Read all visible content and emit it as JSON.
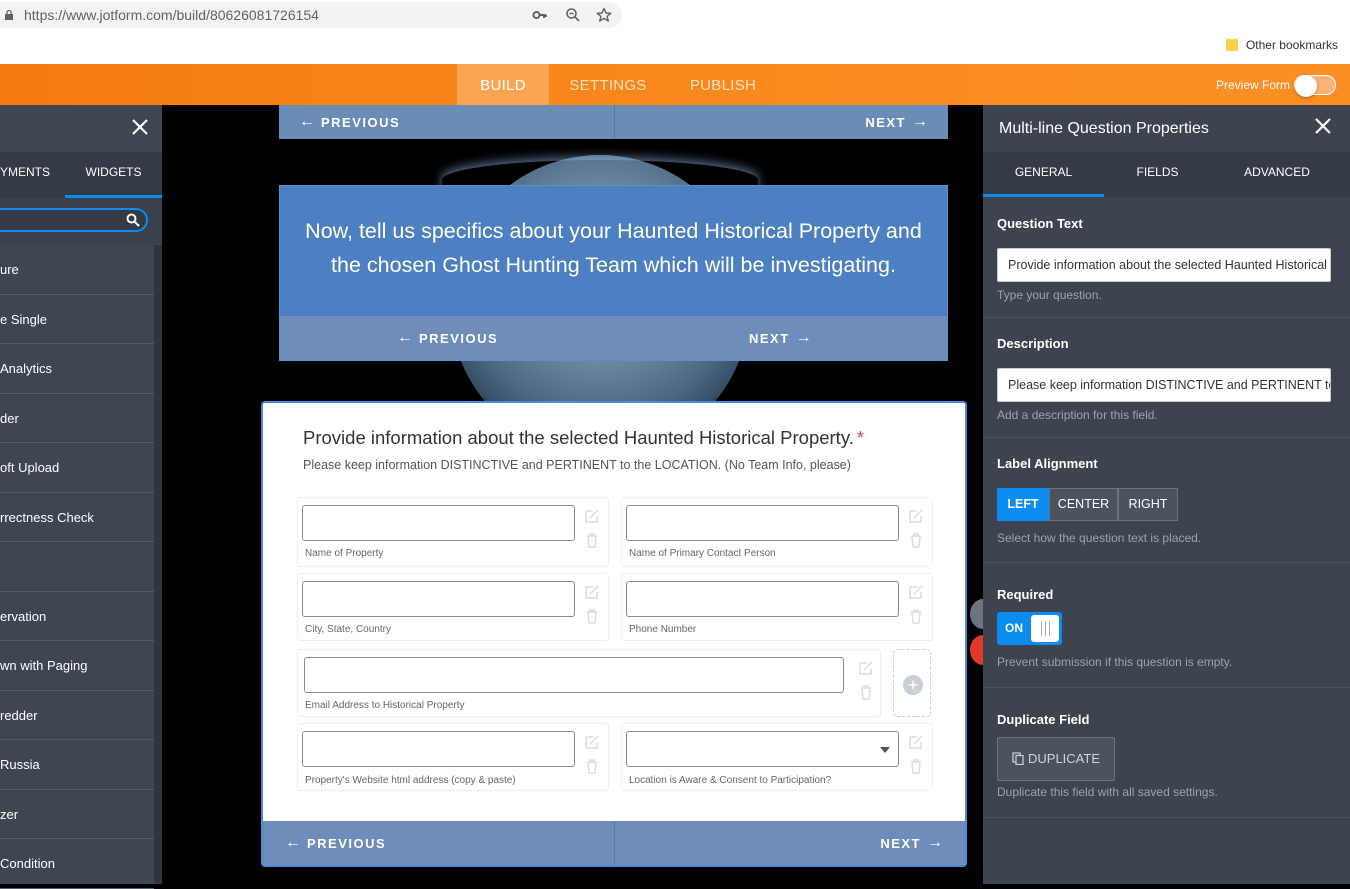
{
  "browser": {
    "url": "https://www.jotform.com/build/80626081726154",
    "bookmarks_label": "Other bookmarks"
  },
  "topbar": {
    "tabs": [
      "BUILD",
      "SETTINGS",
      "PUBLISH"
    ],
    "preview_label": "Preview Form"
  },
  "left_panel": {
    "tabs": [
      "YMENTS",
      "WIDGETS"
    ],
    "items": [
      "ure",
      "e Single",
      "Analytics",
      "der",
      "oft Upload",
      "rrectness Check",
      "",
      "ervation",
      "wn with Paging",
      "redder",
      "Russia",
      "zer",
      "Condition"
    ]
  },
  "form": {
    "nav": {
      "previous": "PREVIOUS",
      "next": "NEXT"
    },
    "hero_text": "Now, tell us specifics about your Haunted Historical Property and the chosen Ghost Hunting Team which will be investigating.",
    "question_title": "Provide information about the selected Haunted Historical Property.",
    "required_mark": "*",
    "question_description": "Please keep information DISTINCTIVE and PERTINENT to the LOCATION.  (No Team Info, please)",
    "fields": {
      "name_of_property": "Name of Property",
      "primary_contact": "Name of Primary Contact Person",
      "city_state_country": "City, State, Country",
      "phone_number": "Phone Number",
      "email_address": "Email Address to Historical Property",
      "website": "Property's Website html address (copy & paste)",
      "location_consent": "Location is Aware & Consent to Participation?"
    }
  },
  "right_panel": {
    "title": "Multi-line Question Properties",
    "tabs": [
      "GENERAL",
      "FIELDS",
      "ADVANCED"
    ],
    "question_text": {
      "label": "Question Text",
      "value": "Provide information about the selected Haunted Historical Property.",
      "hint": "Type your question."
    },
    "description": {
      "label": "Description",
      "value": "Please keep information DISTINCTIVE and PERTINENT to the LOCATION.  (No Team Info, please)",
      "hint": "Add a description for this field."
    },
    "label_alignment": {
      "label": "Label Alignment",
      "options": [
        "LEFT",
        "CENTER",
        "RIGHT"
      ],
      "selected": "LEFT",
      "hint": "Select how the question text is placed."
    },
    "required": {
      "label": "Required",
      "state": "ON",
      "hint": "Prevent submission if this question is empty."
    },
    "duplicate": {
      "label": "Duplicate Field",
      "button": "DUPLICATE",
      "hint": "Duplicate this field with all saved settings."
    }
  },
  "colors": {
    "orange": "#f57c0f",
    "blue_accent": "#0a8cf0",
    "panel_dark": "#3d4450",
    "form_nav": "#6f8dba"
  }
}
